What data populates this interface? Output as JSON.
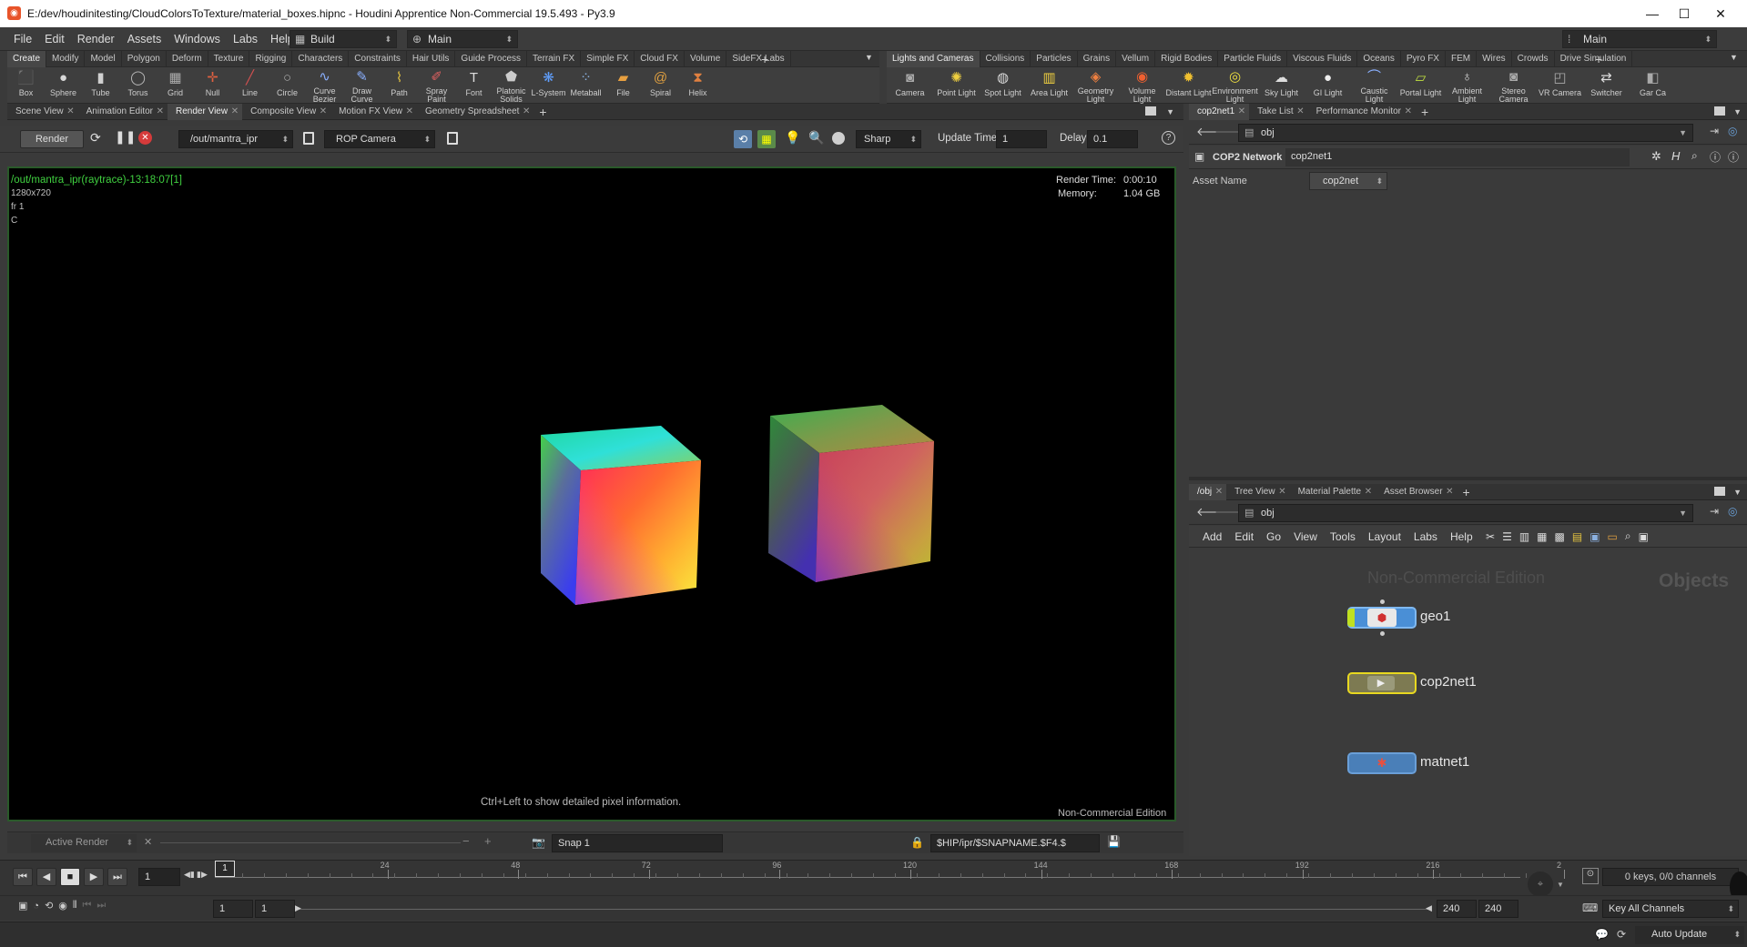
{
  "window": {
    "title": "E:/dev/houdinitesting/CloudColorsToTexture/material_boxes.hipnc - Houdini Apprentice Non-Commercial 19.5.493 - Py3.9",
    "app_icon": "houdini-icon",
    "minimize": "—",
    "maximize": "☐",
    "close": "✕"
  },
  "menu": {
    "items": [
      "File",
      "Edit",
      "Render",
      "Assets",
      "Windows",
      "Labs",
      "Help"
    ],
    "desktop_label": "Build",
    "workspace_label": "Main",
    "right_desktop_label": "Main"
  },
  "shelf_left": {
    "tabs": [
      "Create",
      "Modify",
      "Model",
      "Polygon",
      "Deform",
      "Texture",
      "Rigging",
      "Characters",
      "Constraints",
      "Hair Utils",
      "Guide Process",
      "Terrain FX",
      "Simple FX",
      "Cloud FX",
      "Volume",
      "SideFX Labs"
    ],
    "tools": [
      {
        "label": "Box",
        "icon": "box-icon"
      },
      {
        "label": "Sphere",
        "icon": "sphere-icon"
      },
      {
        "label": "Tube",
        "icon": "tube-icon"
      },
      {
        "label": "Torus",
        "icon": "torus-icon"
      },
      {
        "label": "Grid",
        "icon": "grid-icon"
      },
      {
        "label": "Null",
        "icon": "null-icon"
      },
      {
        "label": "Line",
        "icon": "line-icon"
      },
      {
        "label": "Circle",
        "icon": "circle-icon"
      },
      {
        "label": "Curve Bezier",
        "icon": "curve-bezier-icon"
      },
      {
        "label": "Draw Curve",
        "icon": "draw-curve-icon"
      },
      {
        "label": "Path",
        "icon": "path-icon"
      },
      {
        "label": "Spray Paint",
        "icon": "spray-paint-icon"
      },
      {
        "label": "Font",
        "icon": "font-icon"
      },
      {
        "label": "Platonic Solids",
        "icon": "platonic-icon"
      },
      {
        "label": "L-System",
        "icon": "lsystem-icon"
      },
      {
        "label": "Metaball",
        "icon": "metaball-icon"
      },
      {
        "label": "File",
        "icon": "file-icon"
      },
      {
        "label": "Spiral",
        "icon": "spiral-icon"
      },
      {
        "label": "Helix",
        "icon": "helix-icon"
      }
    ]
  },
  "shelf_right": {
    "tabs": [
      "Lights and Cameras",
      "Collisions",
      "Particles",
      "Grains",
      "Vellum",
      "Rigid Bodies",
      "Particle Fluids",
      "Viscous Fluids",
      "Oceans",
      "Pyro FX",
      "FEM",
      "Wires",
      "Crowds",
      "Drive Simulation"
    ],
    "tools": [
      {
        "label": "Camera",
        "icon": "camera-icon"
      },
      {
        "label": "Point Light",
        "icon": "point-light-icon"
      },
      {
        "label": "Spot Light",
        "icon": "spot-light-icon"
      },
      {
        "label": "Area Light",
        "icon": "area-light-icon"
      },
      {
        "label": "Geometry Light",
        "icon": "geometry-light-icon"
      },
      {
        "label": "Volume Light",
        "icon": "volume-light-icon"
      },
      {
        "label": "Distant Light",
        "icon": "distant-light-icon"
      },
      {
        "label": "Environment Light",
        "icon": "environment-light-icon"
      },
      {
        "label": "Sky Light",
        "icon": "sky-light-icon"
      },
      {
        "label": "GI Light",
        "icon": "gi-light-icon"
      },
      {
        "label": "Caustic Light",
        "icon": "caustic-light-icon"
      },
      {
        "label": "Portal Light",
        "icon": "portal-light-icon"
      },
      {
        "label": "Ambient Light",
        "icon": "ambient-light-icon"
      },
      {
        "label": "Stereo Camera",
        "icon": "stereo-camera-icon"
      },
      {
        "label": "VR Camera",
        "icon": "vr-camera-icon"
      },
      {
        "label": "Switcher",
        "icon": "switcher-icon"
      },
      {
        "label": "Gar Ca",
        "icon": "gamepad-camera-icon"
      }
    ]
  },
  "left_pane": {
    "tabs": [
      "Scene View",
      "Animation Editor",
      "Render View",
      "Composite View",
      "Motion FX View",
      "Geometry Spreadsheet"
    ],
    "active_tab": 2
  },
  "render_view": {
    "render_button": "Render",
    "rop_path": "/out/mantra_ipr",
    "camera": "ROP Camera",
    "filter": "Sharp",
    "update_time_label": "Update Time",
    "update_time_value": "1",
    "delay_label": "Delay",
    "delay_value": "0.1",
    "overlay": {
      "render_name": "/out/mantra_ipr(raytrace)-13:18:07[1]",
      "resolution": "1280x720",
      "frame": "fr 1",
      "channel": "C",
      "render_time_label": "Render Time:",
      "render_time_value": "0:00:10",
      "memory_label": "Memory:",
      "memory_value": "1.04 GB",
      "hint": "Ctrl+Left to show detailed pixel information.",
      "edition": "Non-Commercial Edition"
    },
    "bottom": {
      "active_render": "Active Render",
      "snap": "Snap 1",
      "output_path": "$HIP/ipr/$SNAPNAME.$F4.$"
    }
  },
  "param_pane": {
    "tabs": [
      "cop2net1",
      "Take List",
      "Performance Monitor"
    ],
    "path": "obj",
    "node_type": "COP2 Network",
    "node_name": "cop2net1",
    "asset_name_label": "Asset Name",
    "asset_name_value": "cop2net"
  },
  "network_pane": {
    "tabs": [
      "/obj",
      "Tree View",
      "Material Palette",
      "Asset Browser"
    ],
    "path": "obj",
    "menu": [
      "Add",
      "Edit",
      "Go",
      "View",
      "Tools",
      "Layout",
      "Labs",
      "Help"
    ],
    "watermark": "Non-Commercial Edition",
    "context_label": "Objects",
    "nodes": [
      {
        "name": "geo1",
        "color": "#4a8fd6",
        "icon": "geometry-node-icon"
      },
      {
        "name": "cop2net1",
        "color": "#7d7a52",
        "icon": "cop-network-node-icon"
      },
      {
        "name": "matnet1",
        "color": "#4a7fb8",
        "icon": "material-network-node-icon"
      }
    ]
  },
  "timeline": {
    "current_frame": "1",
    "frame_marker": "1",
    "ticks": [
      "24",
      "48",
      "72",
      "96",
      "120",
      "144",
      "168",
      "192",
      "216",
      "2"
    ],
    "range_start": "1",
    "range_start2": "1",
    "range_end": "240",
    "range_end2": "240",
    "keys_info": "0 keys, 0/0 channels",
    "key_all_channels": "Key All Channels",
    "auto_update": "Auto Update"
  }
}
